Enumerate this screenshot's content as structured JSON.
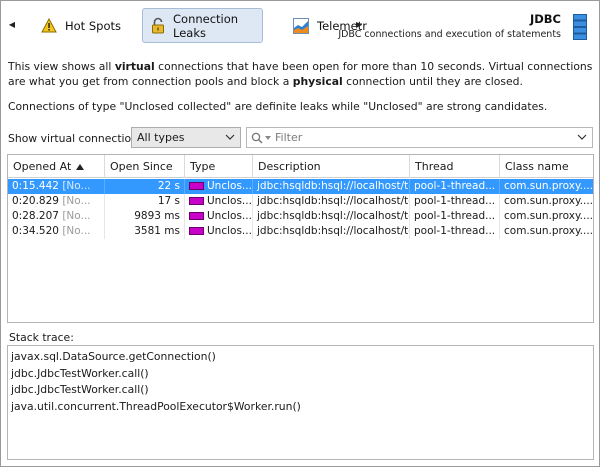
{
  "toolbar": {
    "tabs": [
      {
        "label": "Hot Spots",
        "icon": "warning-icon"
      },
      {
        "label": "Connection Leaks",
        "icon": "lock-icon",
        "selected": true
      },
      {
        "label": "Telemetries",
        "icon": "telemetry-chart-icon"
      }
    ],
    "brand_title": "JDBC",
    "brand_subtitle": "JDBC connections and execution of statements"
  },
  "description": {
    "p1_a": "This view shows all ",
    "p1_b": "virtual",
    "p1_c": " connections that have been open for more than 10 seconds. Virtual connections are what you get from connection pools and block a ",
    "p1_d": "physical",
    "p1_e": " connection until they are closed.",
    "p2": "Connections of type \"Unclosed collected\" are definite leaks while \"Unclosed\" are strong candidates."
  },
  "filter": {
    "show_label": "Show virtual connections:",
    "select_value": "All types",
    "search_placeholder": "Filter"
  },
  "table": {
    "columns": [
      "Opened At",
      "Open Since",
      "Type",
      "Description",
      "Thread",
      "Class name"
    ],
    "rows": [
      {
        "opened_at": "0:15.442",
        "opened_ref": "[No...",
        "open_since": "22 s",
        "type": "Unclos...",
        "description": "jdbc:hsqldb:hsql://localhost/test",
        "thread": "pool-1-thread...",
        "class_name": "com.sun.proxy...."
      },
      {
        "opened_at": "0:20.829",
        "opened_ref": "[No...",
        "open_since": "17 s",
        "type": "Unclos...",
        "description": "jdbc:hsqldb:hsql://localhost/test",
        "thread": "pool-1-thread...",
        "class_name": "com.sun.proxy...."
      },
      {
        "opened_at": "0:28.207",
        "opened_ref": "[No...",
        "open_since": "9893 ms",
        "type": "Unclos...",
        "description": "jdbc:hsqldb:hsql://localhost/test",
        "thread": "pool-1-thread...",
        "class_name": "com.sun.proxy...."
      },
      {
        "opened_at": "0:34.520",
        "opened_ref": "[No...",
        "open_since": "3581 ms",
        "type": "Unclos...",
        "description": "jdbc:hsqldb:hsql://localhost/test",
        "thread": "pool-1-thread...",
        "class_name": "com.sun.proxy...."
      }
    ],
    "selected_row": 0,
    "type_color": "#c800c8",
    "selection_color": "#3399ff"
  },
  "stack_trace": {
    "label": "Stack trace:",
    "frames": [
      "javax.sql.DataSource.getConnection()",
      "jdbc.JdbcTestWorker.call()",
      "jdbc.JdbcTestWorker.call()",
      "java.util.concurrent.ThreadPoolExecutor$Worker.run()"
    ]
  }
}
